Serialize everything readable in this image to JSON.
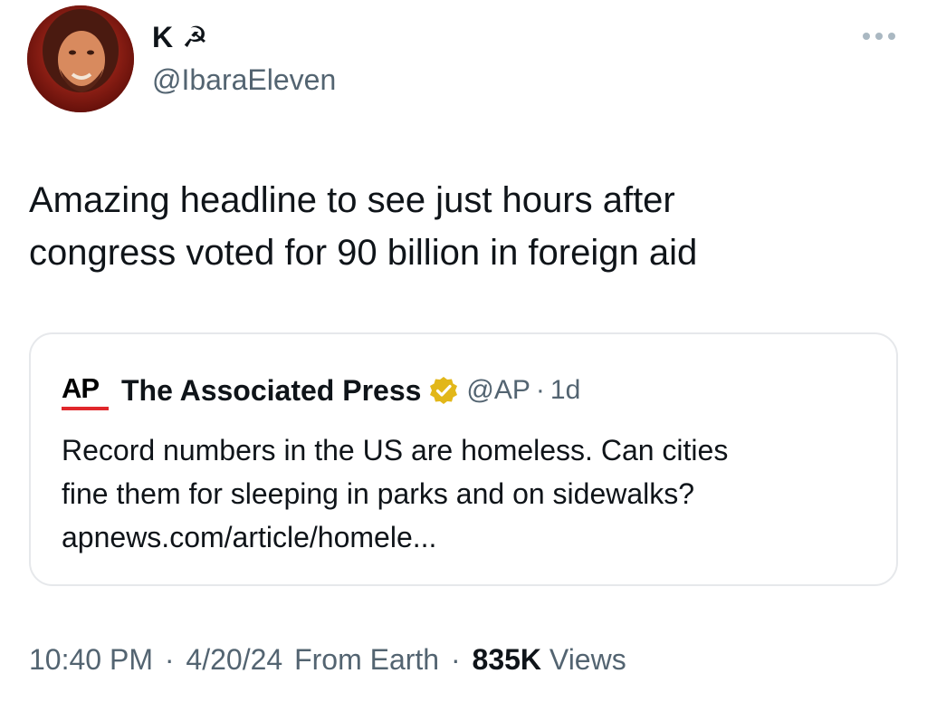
{
  "tweet": {
    "author": {
      "display_name": "K ☭",
      "handle": "@IbaraEleven",
      "avatar_icon": "profile-photo"
    },
    "more_icon": "more-dots-icon",
    "text_line_1": "Amazing headline to see just hours after",
    "text_line_2": "congress voted for 90 billion in foreign aid",
    "quoted": {
      "logo_text": "AP",
      "name": "The Associated Press",
      "verified_icon": "verified-gold-badge-icon",
      "handle": "@AP",
      "separator": "·",
      "age": "1d",
      "text_line_1": "Record numbers in the US are homeless. Can cities",
      "text_line_2": "fine them for sleeping in parks and on sidewalks?",
      "text_line_3": "apnews.com/article/homele..."
    },
    "footer": {
      "time": "10:40 PM",
      "sep1": "·",
      "date": "4/20/24",
      "source": "From Earth",
      "sep2": "·",
      "views_count": "835K",
      "views_label": "Views"
    }
  },
  "colors": {
    "text_primary": "#0f1419",
    "text_secondary": "#536471",
    "card_border": "#e6e8eb",
    "verified_gold": "#e2b719",
    "ap_red": "#e0272b"
  }
}
